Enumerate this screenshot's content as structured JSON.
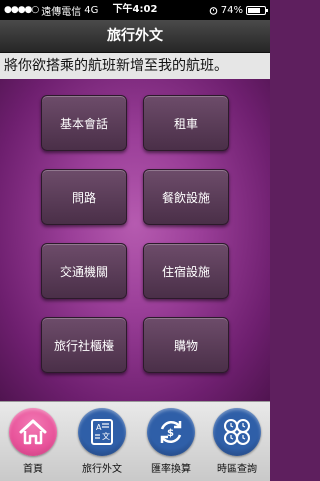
{
  "status_bar": {
    "carrier": "遠傳電信",
    "network": "4G",
    "time": "下午4:02",
    "battery_text": "74%",
    "battery_level": 0.74
  },
  "nav": {
    "title": "旅行外文"
  },
  "marquee": {
    "text": "將你欲搭乘的航班新增至我的航班。"
  },
  "categories": [
    {
      "label": "基本會話"
    },
    {
      "label": "租車"
    },
    {
      "label": "問路"
    },
    {
      "label": "餐飲設施"
    },
    {
      "label": "交通機關"
    },
    {
      "label": "住宿設施"
    },
    {
      "label": "旅行社櫃檯"
    },
    {
      "label": "購物"
    }
  ],
  "tabs": [
    {
      "label": "首頁",
      "icon": "home-icon",
      "color": "#e8539a"
    },
    {
      "label": "旅行外文",
      "icon": "phrasebook-icon",
      "color": "#2f5fa8"
    },
    {
      "label": "匯率換算",
      "icon": "currency-exchange-icon",
      "color": "#2f5fa8"
    },
    {
      "label": "時區查詢",
      "icon": "timezone-icon",
      "color": "#2f5fa8"
    }
  ]
}
